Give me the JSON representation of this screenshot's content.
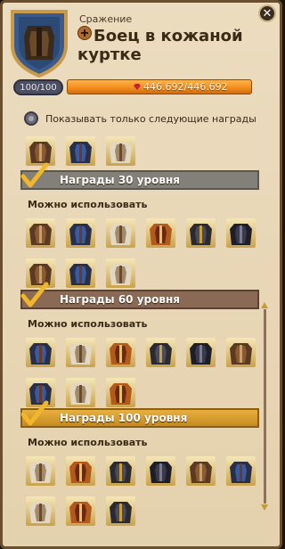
{
  "header": {
    "subtitle": "Сражение",
    "title": "Боец в кожаной куртке"
  },
  "level": {
    "label": "100/100"
  },
  "fame": {
    "value_text": "446.692/446.692"
  },
  "filter": {
    "label": "Показывать только следующие награды",
    "checked": false
  },
  "sections": [
    {
      "title": "Награды 30 уровня",
      "style": "grey",
      "subtitle": "Можно использовать",
      "item_count": 9
    },
    {
      "title": "Награды 60 уровня",
      "style": "brown",
      "subtitle": "Можно использовать",
      "item_count": 9
    },
    {
      "title": "Награды 100 уровня",
      "style": "gold",
      "subtitle": "Можно использовать",
      "item_count": 9
    }
  ],
  "colors": {
    "panel": "#e7d5b4",
    "fame_bar": "#f08c1a",
    "banner_grey": "#83807a",
    "banner_brown": "#8a6a55",
    "banner_gold": "#d9a032",
    "checkmark": "#f2b62a"
  },
  "icons": [
    "close-icon",
    "pvp-icon",
    "fame-gem-icon",
    "checkmark-icon",
    "leather-jacket-icon",
    "scroll-up-icon",
    "scroll-down-icon"
  ]
}
